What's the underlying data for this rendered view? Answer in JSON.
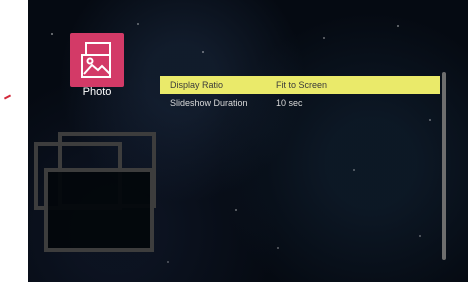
{
  "app": {
    "category_label": "Photo",
    "accent_color": "#d33a67",
    "highlight_color": "#eaea6a"
  },
  "menu": {
    "items": [
      {
        "label": "Display Ratio",
        "value": "Fit to Screen",
        "selected": true
      },
      {
        "label": "Slideshow Duration",
        "value": "10 sec",
        "selected": false
      }
    ]
  }
}
